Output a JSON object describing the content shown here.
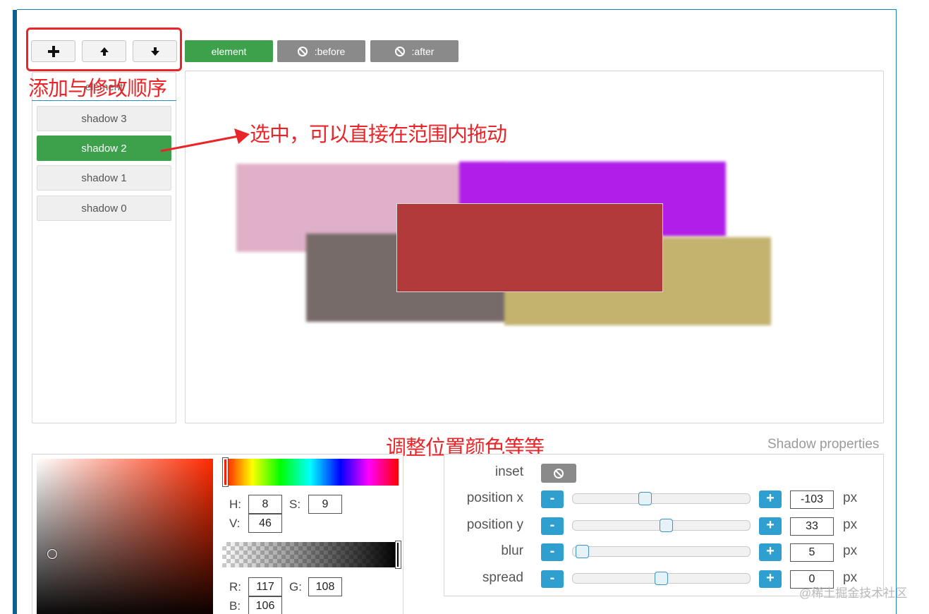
{
  "toolbar": {
    "add_icon": "plus-icon",
    "up_icon": "arrow-up-icon",
    "down_icon": "arrow-down-icon"
  },
  "layers": {
    "element": "element",
    "before": ":before",
    "after": ":after"
  },
  "annotations": {
    "order": "添加与修改顺序",
    "drag": "选中，可以直接在范围内拖动",
    "adjust": "调整位置颜色等等"
  },
  "shadow_list": {
    "header": "element",
    "items": [
      "shadow 3",
      "shadow 2",
      "shadow 1",
      "shadow 0"
    ],
    "selected": "shadow 2"
  },
  "preview": {
    "element_color": "#b33a3a",
    "shadow_colors": [
      "#e0b0c8",
      "#b01ee8",
      "#776b6a",
      "#c3b36e"
    ]
  },
  "color_picker": {
    "h_label": "H:",
    "h": "8",
    "s_label": "S:",
    "s": "9",
    "v_label": "V:",
    "v": "46",
    "r_label": "R:",
    "r": "117",
    "g_label": "G:",
    "g": "108",
    "b_label": "B:",
    "b": "106"
  },
  "properties": {
    "title": "Shadow properties",
    "inset_label": "inset",
    "minus": "-",
    "plus": "+",
    "unit": "px",
    "rows": [
      {
        "label": "position x",
        "value": "-103",
        "slider_pct": 0.4
      },
      {
        "label": "position y",
        "value": "33",
        "slider_pct": 0.53
      },
      {
        "label": "blur",
        "value": "5",
        "slider_pct": 0.02
      },
      {
        "label": "spread",
        "value": "0",
        "slider_pct": 0.5
      }
    ]
  },
  "watermark": "@稀土掘金技术社区"
}
